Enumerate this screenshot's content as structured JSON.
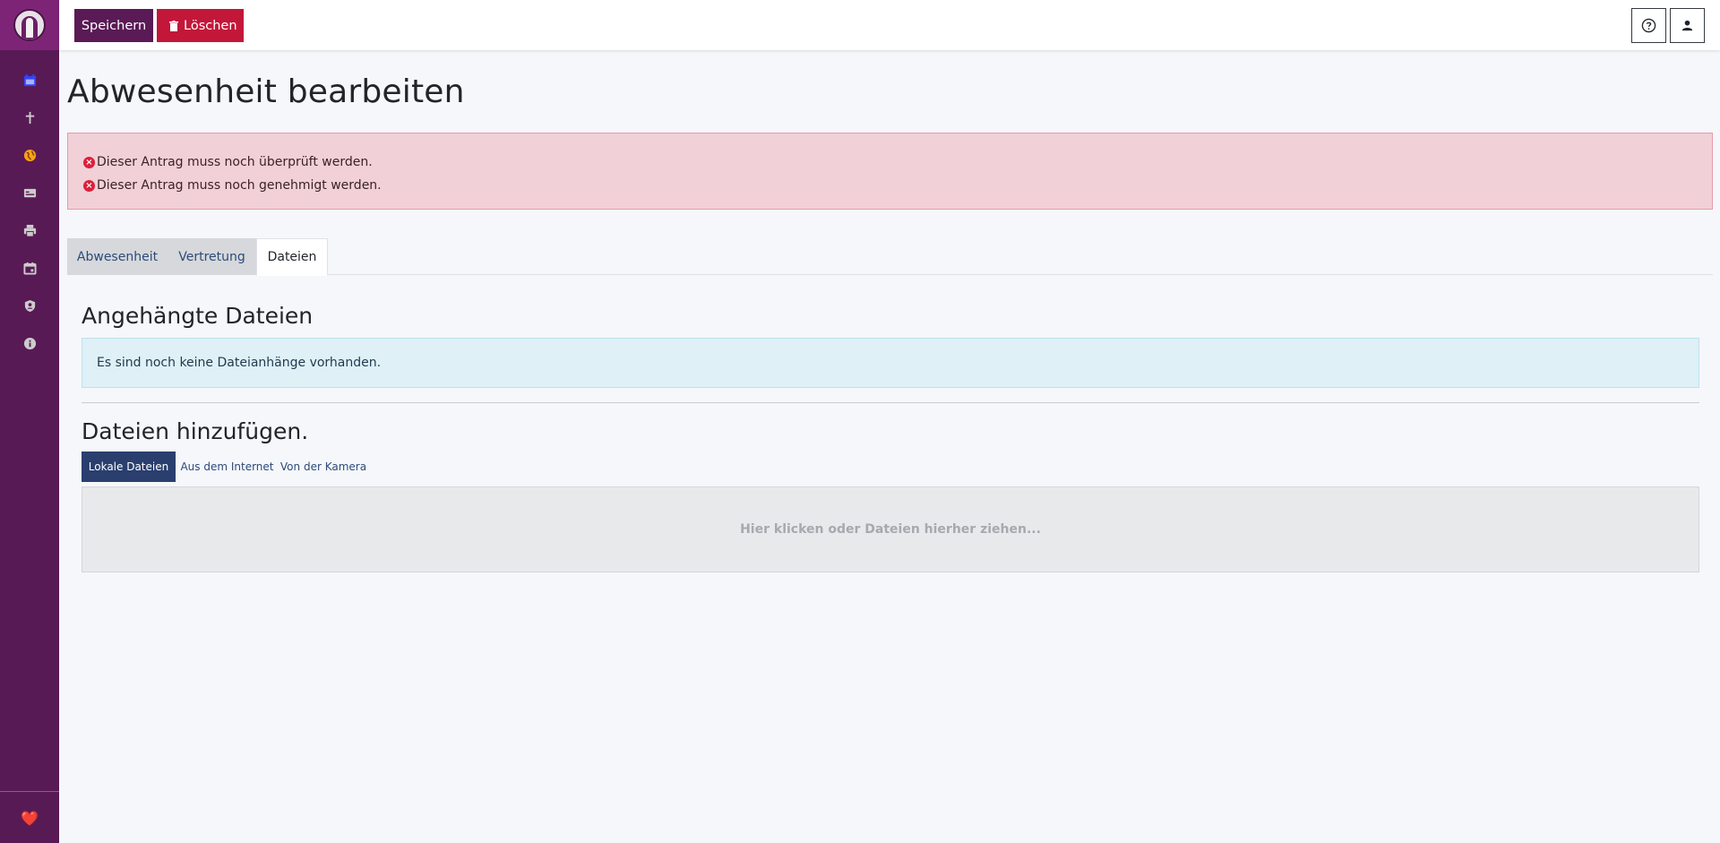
{
  "sidebar": {
    "nav_items": [
      {
        "icon": "calendar-icon",
        "color": "#3344ff"
      },
      {
        "icon": "cross-icon",
        "color": "#cccccc"
      },
      {
        "icon": "globe-icon",
        "color": "#f7a21a"
      },
      {
        "icon": "card-icon",
        "color": "#cccccc"
      },
      {
        "icon": "printer-icon",
        "color": "#cccccc"
      },
      {
        "icon": "calendar-outline-icon",
        "color": "#cccccc"
      },
      {
        "icon": "shield-user-icon",
        "color": "#cccccc"
      },
      {
        "icon": "info-icon",
        "color": "#cccccc"
      }
    ],
    "heart": "❤️"
  },
  "toolbar": {
    "save_label": "Speichern",
    "delete_label": "Löschen"
  },
  "page": {
    "title": "Abwesenheit bearbeiten"
  },
  "alerts": {
    "danger": [
      "Dieser Antrag muss noch überprüft werden.",
      "Dieser Antrag muss noch genehmigt werden."
    ]
  },
  "tabs": [
    {
      "label": "Abwesenheit"
    },
    {
      "label": "Vertretung"
    },
    {
      "label": "Dateien"
    }
  ],
  "files": {
    "attached_heading": "Angehängte Dateien",
    "no_files_text": "Es sind noch keine Dateianhänge vorhanden.",
    "add_heading": "Dateien hinzufügen.",
    "sources": [
      {
        "label": "Lokale Dateien"
      },
      {
        "label": "Aus dem Internet"
      },
      {
        "label": "Von der Kamera"
      }
    ],
    "dropzone_text": "Hier klicken oder Dateien hierher ziehen..."
  },
  "colors": {
    "sidebar": "#581a55",
    "primary": "#5a1a55",
    "danger": "#c3173a",
    "active_source": "#2a3f6e"
  }
}
